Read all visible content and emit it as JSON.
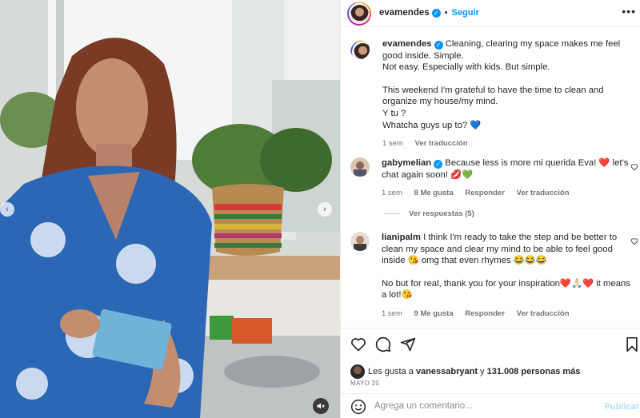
{
  "post": {
    "author": "evamendes",
    "follow_label": "Seguir",
    "separator": "•",
    "more_glyph": "•••",
    "verified_glyph": "✓",
    "caption": {
      "line1": "Cleaning, clearing my space makes me feel good inside. Simple.",
      "line2": "Not easy. Especially with kids. But simple.",
      "line3": "This weekend I'm grateful to have the time to clean and organize my house/my mind.",
      "line4": "Y tu ?",
      "line5": "Whatcha guys up to? 💙"
    },
    "caption_time": "1 sem",
    "caption_translate": "Ver traducción"
  },
  "comments": [
    {
      "user": "gabymelian",
      "verified": true,
      "text": "Because less is more mi querida Eva! ❤️ let's chat again soon! 💋💚",
      "time": "1 sem",
      "likes": "8 Me gusta",
      "reply": "Responder",
      "translate": "Ver traducción",
      "view_replies": "Ver respuestas (5)"
    },
    {
      "user": "lianipalm",
      "verified": false,
      "text1": "I think I'm ready to take the step and be better to clean my space and clear my mind to be able to feel good inside 😘 omg that even rhymes 😂😂😂",
      "text2": "No but for real, thank you for your inspiration❤️🙏🏻❤️ it means a lot!😘",
      "time": "1 sem",
      "likes": "9 Me gusta",
      "reply": "Responder",
      "translate": "Ver traducción"
    }
  ],
  "likes_bar": {
    "prefix": "Les gusta a",
    "user": "vanessabryant",
    "connector": "y",
    "others": "131.008 personas más",
    "date": "MAYO 20"
  },
  "composer": {
    "placeholder": "Agrega un comentario...",
    "post_label": "Publicar"
  },
  "icons": [
    "heart-icon",
    "comment-icon",
    "share-icon",
    "bookmark-icon",
    "emoji-icon",
    "mute-icon",
    "chevron-left-icon",
    "chevron-right-icon",
    "verified-icon",
    "more-icon"
  ],
  "colors": {
    "accent": "#0095f6",
    "text": "#262626",
    "muted": "#737373",
    "post_disabled": "#b2dffc"
  }
}
